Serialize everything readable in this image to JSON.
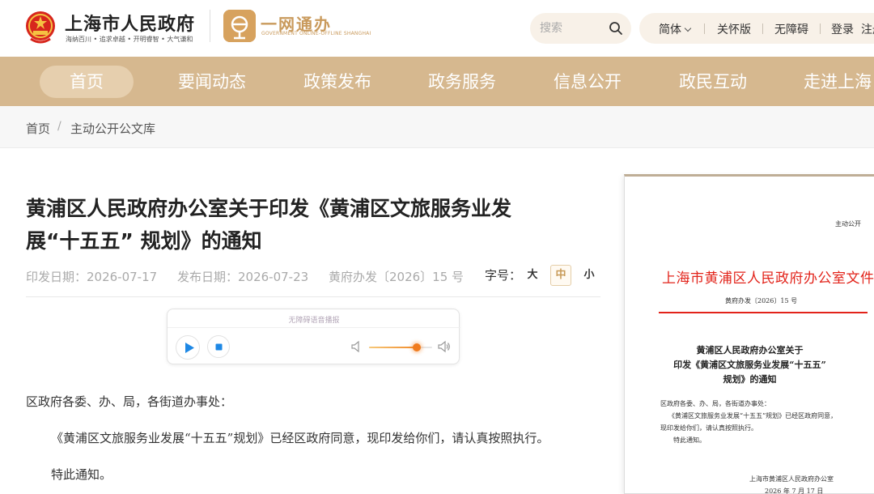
{
  "header": {
    "site_title": "上海市人民政府",
    "site_slogan": "海纳百川 • 追求卓越 • 开明睿智 • 大气谦和",
    "ywtb_title": "一网通办",
    "ywtb_subtitle": "GOVERNMENT ONLINE-OFFLINE SHANGHAI",
    "search_placeholder": "搜索",
    "links": {
      "simplified": "简体",
      "care": "关怀版",
      "accessible": "无障碍",
      "login": "登录",
      "register": "注册"
    }
  },
  "nav": {
    "items": [
      "首页",
      "要闻动态",
      "政策发布",
      "政务服务",
      "信息公开",
      "政民互动",
      "走进上海"
    ],
    "active_index": 0
  },
  "breadcrumb": {
    "home": "首页",
    "separator": "/",
    "current": "主动公开公文库"
  },
  "article": {
    "title_line1": "黄浦区人民政府办公室关于印发《黄浦区文旅服务业发",
    "title_line2": "展“十五五” 规划》的通知",
    "print_date": "印发日期：2026-07-17",
    "publish_date": "发布日期：2026-07-23",
    "doc_number": "黄府办发〔2026〕15 号",
    "font_size_label": "字号：",
    "font_sizes": [
      "大",
      "中",
      "小"
    ],
    "font_size_active": "中",
    "player": {
      "title": "无障碍语音播报",
      "volume": 0.75
    },
    "paragraphs": {
      "salutation": "区政府各委、办、局，各街道办事处：",
      "body": "《黄浦区文旅服务业发展“十五五”规划》已经区政府同意，现印发给你们，请认真按照执行。",
      "closing": "特此通知。"
    }
  },
  "document_preview": {
    "tag": "主动公开",
    "header": "上海市黄浦区人民政府办公室文件",
    "number": "黄府办发〔2026〕15 号",
    "title_line1": "黄浦区人民政府办公室关于",
    "title_line2": "印发《黄浦区文旅服务业发展“十五五”",
    "title_line3": "规划》的通知",
    "salutation": "区政府各委、办、局，各街道办事处：",
    "body_line1": "《黄浦区文旅服务业发展“十五五”规划》已经区政府同意，",
    "body_line2": "现印发给你们，请认真按照执行。",
    "closing": "特此通知。",
    "signature": "上海市黄浦区人民政府办公室",
    "date": "2026 年 7 月 17 日"
  },
  "colors": {
    "nav_bg": "#d6b88f",
    "nav_active": "#e6cfae",
    "accent_gold": "#c99a5c",
    "doc_red": "#e2231a"
  }
}
